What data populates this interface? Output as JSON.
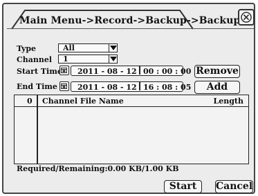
{
  "window": {
    "title": "Main Menu->Record->Backup->Backup"
  },
  "form": {
    "type_label": "Type",
    "type_value": "All",
    "channel_label": "Channel",
    "channel_value": "1",
    "start_label": "Start Time",
    "start_date": "2011 - 08 - 12",
    "start_time": "00 : 00 : 00",
    "end_label": "End Time",
    "end_date": "2011 - 08 - 12",
    "end_time": "16 : 08 : 05"
  },
  "buttons": {
    "remove": "Remove",
    "add": "Add",
    "start": "Start",
    "cancel": "Cancel"
  },
  "table": {
    "col_count": "0",
    "col_name": "Channel File Name",
    "col_length": "Length",
    "rows": []
  },
  "status": {
    "text": "Required/Remaining:0.00 KB/1.00 KB"
  }
}
